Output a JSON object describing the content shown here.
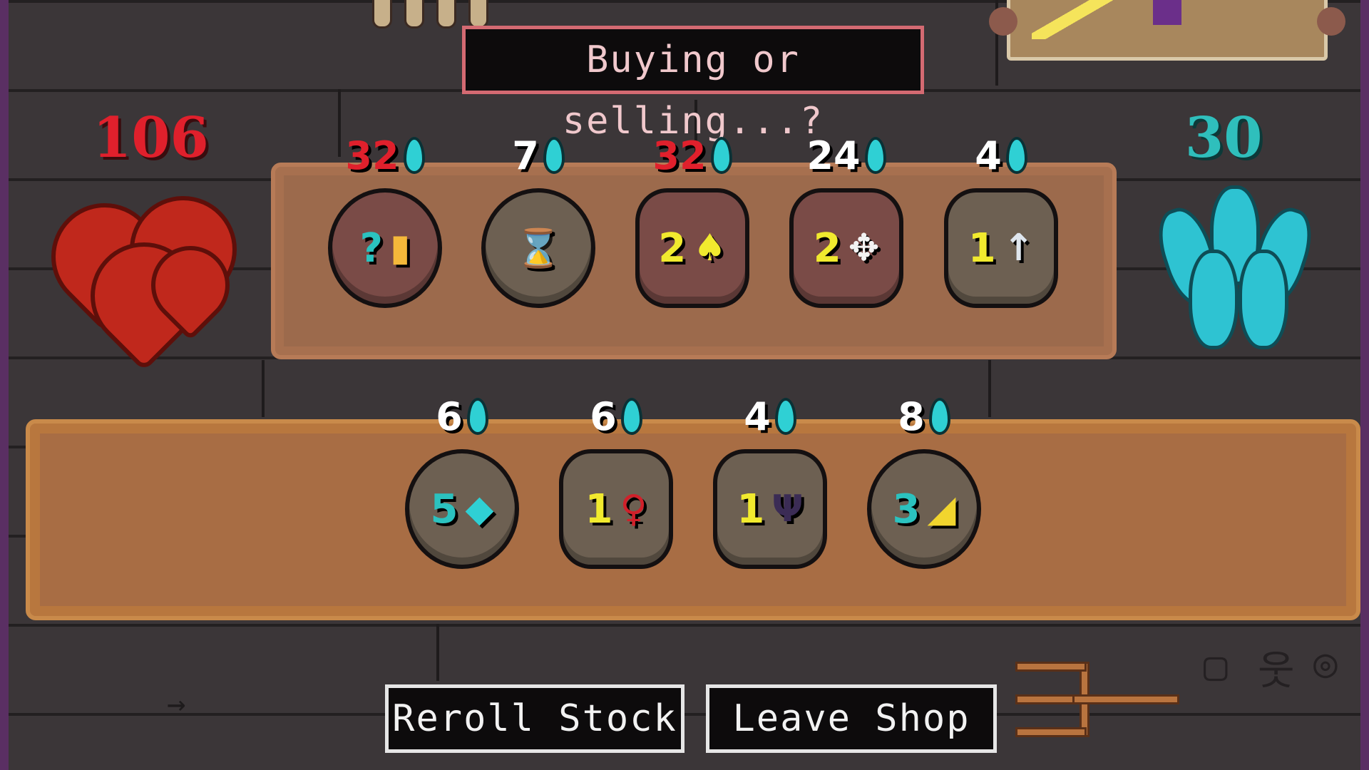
{
  "dialogue": {
    "text": "Buying or selling...?"
  },
  "player": {
    "health": "106",
    "mana": "30"
  },
  "colors": {
    "health": "#e0202c",
    "mana": "#2fbfbc",
    "speech_border": "#d46a72",
    "shelf": "#b8773e"
  },
  "shop_stock": [
    {
      "price": "32",
      "affordable": false,
      "icon": "question-lantern-icon",
      "value": "?",
      "glyph": "▮",
      "style": "red"
    },
    {
      "price": "7",
      "affordable": true,
      "icon": "spool-icon",
      "value": "",
      "glyph": "⌛",
      "style": "gray"
    },
    {
      "price": "32",
      "affordable": false,
      "icon": "torch-icon",
      "value": "2",
      "glyph": "♠",
      "style": "red"
    },
    {
      "price": "24",
      "affordable": true,
      "icon": "beetle-icon",
      "value": "2",
      "glyph": "✥",
      "style": "red"
    },
    {
      "price": "4",
      "affordable": true,
      "icon": "needle-icon",
      "value": "1",
      "glyph": "↑",
      "style": "gray"
    }
  ],
  "player_items": [
    {
      "price": "6",
      "icon": "mana-gem-icon",
      "value": "5",
      "glyph": "◆"
    },
    {
      "price": "6",
      "icon": "red-key-icon",
      "value": "1",
      "glyph": "♀"
    },
    {
      "price": "4",
      "icon": "trident-icon",
      "value": "1",
      "glyph": "Ψ"
    },
    {
      "price": "8",
      "icon": "cheese-icon",
      "value": "3",
      "glyph": "◢"
    }
  ],
  "buttons": {
    "reroll": "Reroll Stock",
    "leave": "Leave Shop"
  }
}
